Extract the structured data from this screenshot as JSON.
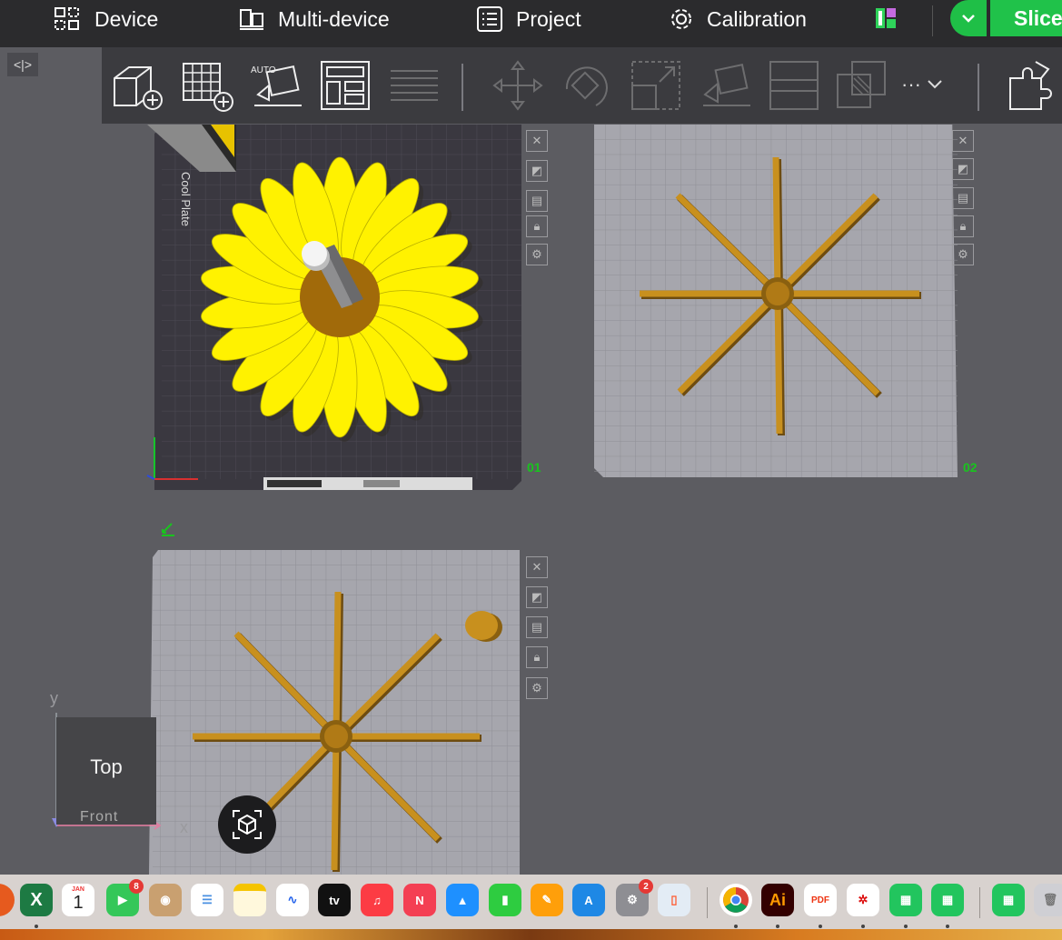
{
  "topbar": {
    "device": "Device",
    "multi_device": "Multi-device",
    "project": "Project",
    "calibration": "Calibration",
    "slice": "Slice"
  },
  "toolbar": {
    "auto_label": "AUTO",
    "more_label": "···"
  },
  "plates": [
    {
      "number": "01",
      "bed_label": "Cool Plate"
    },
    {
      "number": "02"
    },
    {
      "number": ""
    }
  ],
  "viewport": {
    "axis_y": "y",
    "axis_x": "x",
    "view_cube_label": "Top",
    "view_cube_front": "Front"
  },
  "dock": {
    "calendar_month": "JAN",
    "calendar_day": "1",
    "facetime_badge": "8",
    "settings_badge": "2",
    "appletv_label": "tv",
    "illustrator_label": "Ai",
    "pdf_label": "PDF"
  },
  "colors": {
    "slice_green": "#20c24a",
    "flower_yellow": "#fff200",
    "spoke_orange": "#c8901e",
    "plate_dark": "#3a3840"
  }
}
